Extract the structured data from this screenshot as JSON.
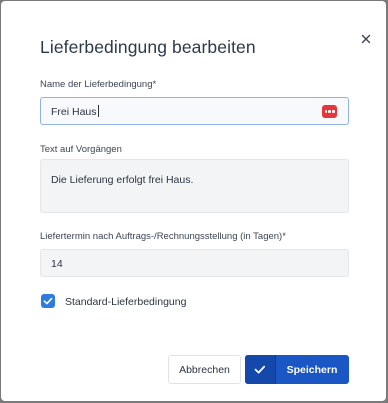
{
  "dialog": {
    "title": "Lieferbedingung bearbeiten",
    "close_icon": "close-icon"
  },
  "fields": {
    "name": {
      "label": "Name der Lieferbedingung*",
      "value": "Frei Haus",
      "action_icon": "more-dots-icon"
    },
    "text": {
      "label": "Text auf Vorgängen",
      "value": "Die Lieferung erfolgt frei Haus."
    },
    "delivery_days": {
      "label": "Liefertermin nach Auftrags-/Rechnungsstellung (in Tagen)*",
      "value": "14"
    }
  },
  "default_checkbox": {
    "label": "Standard-Lieferbedingung",
    "checked": true
  },
  "buttons": {
    "cancel": "Abbrechen",
    "save": "Speichern",
    "save_icon": "check-icon"
  },
  "colors": {
    "primary": "#1a56c4",
    "checkbox": "#2f7ce0",
    "dots_button": "#e4373c"
  }
}
